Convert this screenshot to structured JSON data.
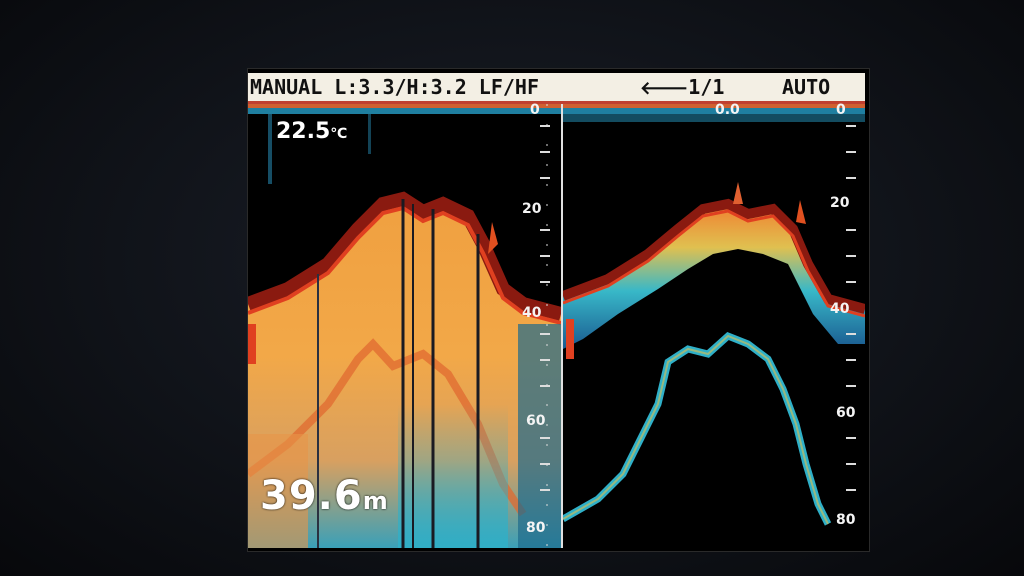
{
  "header": {
    "mode": "MANUAL L:3.3/H:3.2 LF/HF",
    "page_arrow": "🡐",
    "page": "1/1",
    "auto": "AUTO"
  },
  "readouts": {
    "temperature": "22.5",
    "temperature_unit": "℃",
    "depth": "39.6",
    "depth_unit": "m"
  },
  "left_scale": [
    "0",
    "20",
    "40",
    "60",
    "80"
  ],
  "right_scale": [
    "0",
    "20",
    "40",
    "60",
    "80"
  ],
  "right_top_label": "0.0",
  "colors": {
    "header_bg": "#f3efe4",
    "echo_strong": "#d23a1a",
    "echo_mid": "#f2a040",
    "echo_weak": "#2fb0c8",
    "screen_bg": "#000000"
  }
}
